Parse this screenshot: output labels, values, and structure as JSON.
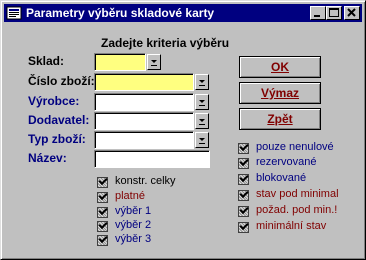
{
  "window": {
    "title": "Parametry výběru skladové karty",
    "controls": {
      "minimize": "minimize-icon",
      "maximize": "maximize-icon",
      "close": "close-icon"
    }
  },
  "form": {
    "heading": "Zadejte kriteria výběru",
    "fields": {
      "sklad": {
        "label": "Sklad:",
        "value": ""
      },
      "cislo_zbozi": {
        "label": "Číslo zboží:",
        "value": ""
      },
      "vyrobce": {
        "label": "Výrobce:",
        "value": ""
      },
      "dodavatel": {
        "label": "Dodavatel:",
        "value": ""
      },
      "typ_zbozi": {
        "label": "Typ zboží:",
        "value": ""
      },
      "nazev": {
        "label": "Název:",
        "value": ""
      }
    }
  },
  "buttons": {
    "ok": "OK",
    "vymaz": "Výmaz",
    "zpet": "Zpět"
  },
  "checkboxes_left": [
    {
      "label": "konstr. celky",
      "color": "#000000",
      "checked": true
    },
    {
      "label": "platné",
      "color": "#800000",
      "checked": true
    },
    {
      "label": "výběr 1",
      "color": "#000080",
      "checked": true
    },
    {
      "label": "výběr 2",
      "color": "#000080",
      "checked": true
    },
    {
      "label": "výběr 3",
      "color": "#000080",
      "checked": true
    }
  ],
  "checkboxes_right": [
    {
      "label": "pouze nenulové",
      "color": "#000080",
      "checked": true
    },
    {
      "label": "rezervované",
      "color": "#000080",
      "checked": true
    },
    {
      "label": "blokované",
      "color": "#000080",
      "checked": true
    },
    {
      "label": "stav pod minimal",
      "color": "#800000",
      "checked": true
    },
    {
      "label": "požad. pod min.!",
      "color": "#800000",
      "checked": true
    },
    {
      "label": "minimální stav",
      "color": "#800000",
      "checked": true
    }
  ],
  "colors": {
    "titlebar": "#000080",
    "face": "#c0c0c0",
    "highlight_field": "#ffff80",
    "label_blue": "#000080",
    "label_red": "#800000"
  }
}
